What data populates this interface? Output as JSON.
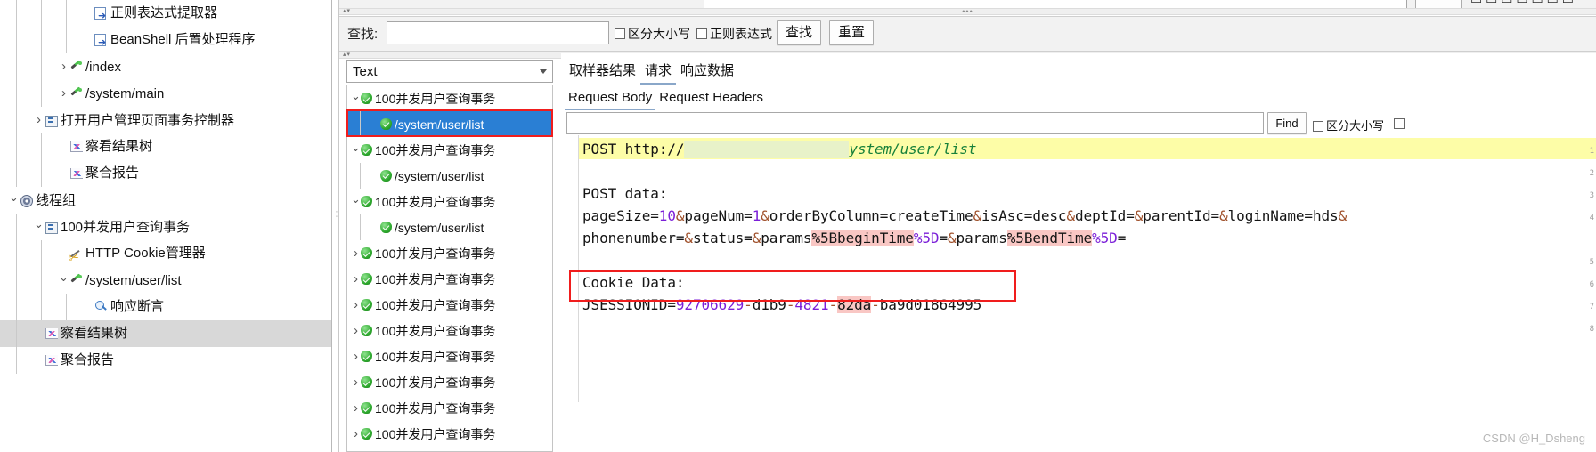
{
  "app": {
    "watermark": "CSDN @H_Dsheng"
  },
  "left_tree": {
    "items": [
      {
        "label": "正则表达式提取器",
        "indent": 3,
        "twisty": "none",
        "icon": "post-processor-icon",
        "selected": false
      },
      {
        "label": "BeanShell 后置处理程序",
        "indent": 3,
        "twisty": "none",
        "icon": "post-processor-icon",
        "selected": false
      },
      {
        "label": "/index",
        "indent": 2,
        "twisty": "closed",
        "icon": "http-sampler-icon",
        "selected": false
      },
      {
        "label": "/system/main",
        "indent": 2,
        "twisty": "closed",
        "icon": "http-sampler-icon",
        "selected": false
      },
      {
        "label": "打开用户管理页面事务控制器",
        "indent": 1,
        "twisty": "closed",
        "icon": "transaction-controller-icon",
        "selected": false
      },
      {
        "label": "察看结果树",
        "indent": 2,
        "twisty": "none",
        "icon": "view-results-tree-icon",
        "selected": false
      },
      {
        "label": "聚合报告",
        "indent": 2,
        "twisty": "none",
        "icon": "aggregate-report-icon",
        "selected": false
      },
      {
        "label": "线程组",
        "indent": 0,
        "twisty": "open",
        "icon": "thread-group-icon",
        "selected": false
      },
      {
        "label": "100并发用户查询事务",
        "indent": 1,
        "twisty": "open",
        "icon": "transaction-controller-icon",
        "selected": false
      },
      {
        "label": "HTTP Cookie管理器",
        "indent": 2,
        "twisty": "none",
        "icon": "cookie-manager-icon",
        "selected": false
      },
      {
        "label": "/system/user/list",
        "indent": 2,
        "twisty": "open",
        "icon": "http-sampler-icon",
        "selected": false
      },
      {
        "label": "响应断言",
        "indent": 3,
        "twisty": "none",
        "icon": "response-assertion-icon",
        "selected": false
      },
      {
        "label": "察看结果树",
        "indent": 1,
        "twisty": "none",
        "icon": "view-results-tree-icon",
        "selected": true
      },
      {
        "label": "聚合报告",
        "indent": 1,
        "twisty": "none",
        "icon": "aggregate-report-icon",
        "selected": false
      }
    ]
  },
  "search_bar": {
    "find_label": "查找:",
    "find_value": "",
    "case_sensitive_label": "区分大小写",
    "regex_label": "正则表达式",
    "find_button": "查找",
    "reset_button": "重置"
  },
  "result_panel": {
    "render_combo_value": "Text",
    "rows": [
      {
        "label": "100并发用户查询事务",
        "indent": 0,
        "twisty": "open",
        "selected": false
      },
      {
        "label": "/system/user/list",
        "indent": 1,
        "twisty": "none",
        "selected": true
      },
      {
        "label": "100并发用户查询事务",
        "indent": 0,
        "twisty": "open",
        "selected": false
      },
      {
        "label": "/system/user/list",
        "indent": 1,
        "twisty": "none",
        "selected": false
      },
      {
        "label": "100并发用户查询事务",
        "indent": 0,
        "twisty": "open",
        "selected": false
      },
      {
        "label": "/system/user/list",
        "indent": 1,
        "twisty": "none",
        "selected": false
      },
      {
        "label": "100并发用户查询事务",
        "indent": 0,
        "twisty": "closed",
        "selected": false
      },
      {
        "label": "100并发用户查询事务",
        "indent": 0,
        "twisty": "closed",
        "selected": false
      },
      {
        "label": "100并发用户查询事务",
        "indent": 0,
        "twisty": "closed",
        "selected": false
      },
      {
        "label": "100并发用户查询事务",
        "indent": 0,
        "twisty": "closed",
        "selected": false
      },
      {
        "label": "100并发用户查询事务",
        "indent": 0,
        "twisty": "closed",
        "selected": false
      },
      {
        "label": "100并发用户查询事务",
        "indent": 0,
        "twisty": "closed",
        "selected": false
      },
      {
        "label": "100并发用户查询事务",
        "indent": 0,
        "twisty": "closed",
        "selected": false
      },
      {
        "label": "100并发用户查询事务",
        "indent": 0,
        "twisty": "closed",
        "selected": false
      }
    ]
  },
  "detail_panel": {
    "main_tabs": [
      {
        "label": "取样器结果",
        "active": false
      },
      {
        "label": "请求",
        "active": true
      },
      {
        "label": "响应数据",
        "active": false
      }
    ],
    "sub_tabs": [
      {
        "label": "Request Body",
        "active": true
      },
      {
        "label": "Request Headers",
        "active": false
      }
    ],
    "search_value": "",
    "find_button": "Find",
    "case_sensitive_label": "区分大小写",
    "body": {
      "lines": [
        {
          "n": "1",
          "highlight": "yellow",
          "segments": [
            {
              "t": "POST http://",
              "c": "dark"
            },
            {
              "t": "",
              "c": "redact"
            },
            {
              "t": "ystem/user/list",
              "c": "green"
            }
          ]
        },
        {
          "n": "2",
          "highlight": "none",
          "segments": []
        },
        {
          "n": "3",
          "highlight": "none",
          "segments": [
            {
              "t": "POST data:",
              "c": "dark"
            }
          ]
        },
        {
          "n": "4",
          "highlight": "none",
          "segments": [
            {
              "t": "pageSize=",
              "c": "dark"
            },
            {
              "t": "10",
              "c": "purple"
            },
            {
              "t": "&",
              "c": "rust"
            },
            {
              "t": "pageNum=",
              "c": "dark"
            },
            {
              "t": "1",
              "c": "purple"
            },
            {
              "t": "&",
              "c": "rust"
            },
            {
              "t": "orderByColumn=createTime",
              "c": "dark"
            },
            {
              "t": "&",
              "c": "rust"
            },
            {
              "t": "isAsc=desc",
              "c": "dark"
            },
            {
              "t": "&",
              "c": "rust"
            },
            {
              "t": "deptId=",
              "c": "dark"
            },
            {
              "t": "&",
              "c": "rust"
            },
            {
              "t": "parentId=",
              "c": "dark"
            },
            {
              "t": "&",
              "c": "rust"
            },
            {
              "t": "loginName=hds",
              "c": "dark"
            },
            {
              "t": "&",
              "c": "rust"
            }
          ]
        },
        {
          "n": "",
          "highlight": "none",
          "segments": [
            {
              "t": "phonenumber=",
              "c": "dark"
            },
            {
              "t": "&",
              "c": "rust"
            },
            {
              "t": "status=",
              "c": "dark"
            },
            {
              "t": "&",
              "c": "rust"
            },
            {
              "t": "params",
              "c": "dark"
            },
            {
              "t": "%5BbeginTime",
              "c": "pink"
            },
            {
              "t": "%5D",
              "c": "purple"
            },
            {
              "t": "=",
              "c": "dark"
            },
            {
              "t": "&",
              "c": "rust"
            },
            {
              "t": "params",
              "c": "dark"
            },
            {
              "t": "%5BendTime",
              "c": "pink"
            },
            {
              "t": "%5D",
              "c": "purple"
            },
            {
              "t": "=",
              "c": "dark"
            }
          ]
        },
        {
          "n": "5",
          "highlight": "none",
          "segments": []
        },
        {
          "n": "6",
          "highlight": "none",
          "segments": [
            {
              "t": "Cookie Data:",
              "c": "dark"
            }
          ]
        },
        {
          "n": "7",
          "highlight": "none",
          "segments": [
            {
              "t": "JSESSIONID=",
              "c": "dark"
            },
            {
              "t": "92706629",
              "c": "purple"
            },
            {
              "t": "-",
              "c": "rust"
            },
            {
              "t": "d1b9",
              "c": "dark"
            },
            {
              "t": "-",
              "c": "rust"
            },
            {
              "t": "4821",
              "c": "purple"
            },
            {
              "t": "-",
              "c": "rust"
            },
            {
              "t": "82da",
              "c": "pink"
            },
            {
              "t": "-",
              "c": "rust"
            },
            {
              "t": "ba9d01864995",
              "c": "dark"
            }
          ]
        },
        {
          "n": "8",
          "highlight": "none",
          "segments": []
        }
      ]
    }
  },
  "colors": {
    "selection_blue": "#2a7fd4",
    "highlight_red_box": "#f01d1d",
    "code_highlight_yellow": "#fdfda7",
    "code_highlight_pink": "#f9c7c4",
    "tree_selected_gray": "#d8d8d8"
  }
}
